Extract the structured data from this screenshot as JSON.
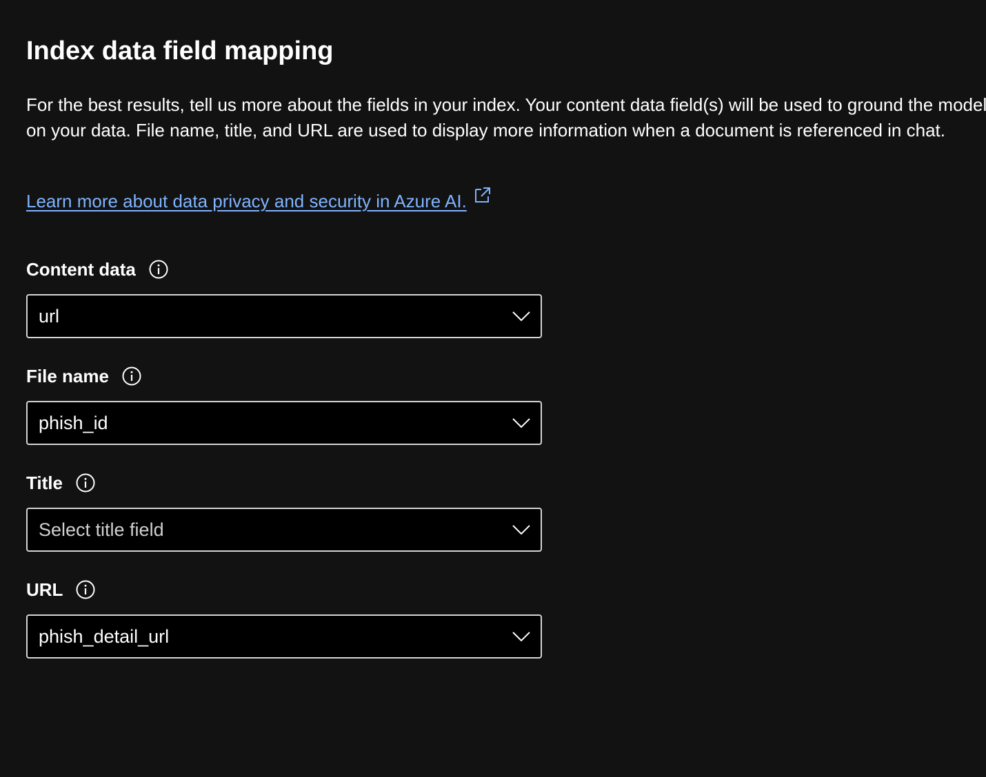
{
  "header": {
    "title": "Index data field mapping"
  },
  "description": "For the best results, tell us more about the fields in your index. Your content data field(s) will be used to ground the model on your data. File name, title, and URL are used to display more information when a document is referenced in chat.",
  "learn_more": {
    "text": "Learn more about data privacy and security in Azure AI.",
    "icon": "external-link-icon"
  },
  "fields": {
    "content_data": {
      "label": "Content data",
      "value": "url",
      "placeholder": ""
    },
    "file_name": {
      "label": "File name",
      "value": "phish_id",
      "placeholder": ""
    },
    "title": {
      "label": "Title",
      "value": "",
      "placeholder": "Select title field"
    },
    "url": {
      "label": "URL",
      "value": "phish_detail_url",
      "placeholder": ""
    }
  },
  "icons": {
    "info": "info-icon",
    "dropdown": "chevron-down-icon"
  },
  "colors": {
    "background": "#121212",
    "link": "#7fb4ff",
    "text": "#ffffff",
    "input_border": "#d6d6d6",
    "input_background": "#000000"
  }
}
